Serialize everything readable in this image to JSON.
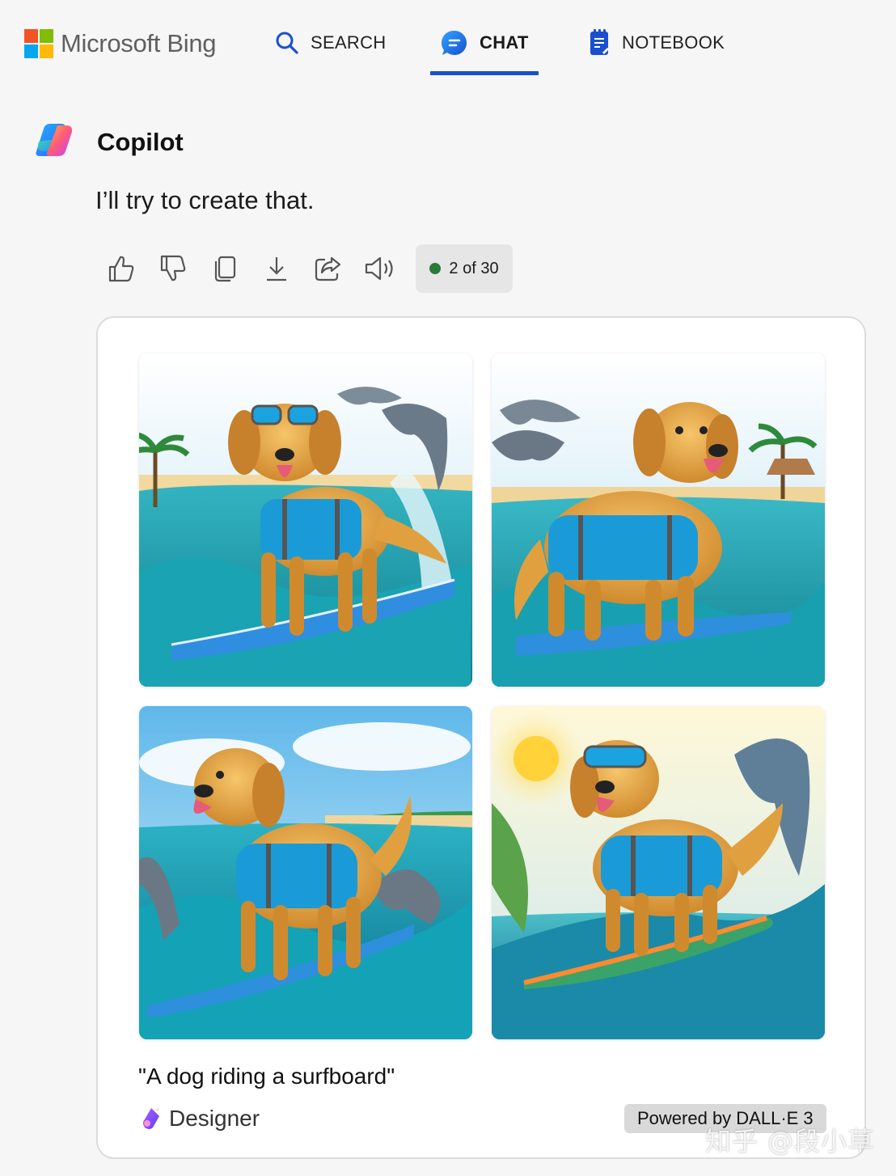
{
  "header": {
    "brand": "Microsoft Bing",
    "tabs": [
      {
        "label": "SEARCH",
        "icon": "search-icon"
      },
      {
        "label": "CHAT",
        "icon": "chat-bubble-icon",
        "active": true
      },
      {
        "label": "NOTEBOOK",
        "icon": "notebook-icon"
      }
    ],
    "accent": "#1a4fd0"
  },
  "copilot": {
    "title": "Copilot",
    "message": "I’ll try to create that."
  },
  "actions": {
    "icons": [
      "thumbs-up-icon",
      "thumbs-down-icon",
      "copy-icon",
      "download-icon",
      "share-icon",
      "speaker-icon"
    ],
    "counter": "2 of 30",
    "counter_dot_color": "#2b7a3b"
  },
  "card": {
    "prompt": "\"A dog riding a surfboard\"",
    "designer": "Designer",
    "powered_by": "Powered by DALL·E 3"
  },
  "watermark": "知乎 @段小草"
}
